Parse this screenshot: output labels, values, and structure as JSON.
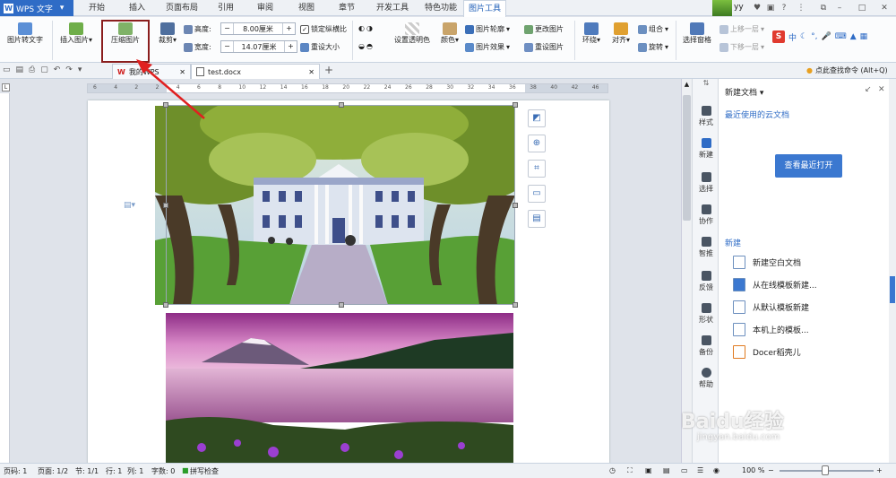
{
  "app": {
    "logo_text": "WPS 文字"
  },
  "menu": {
    "tabs": [
      "开始",
      "插入",
      "页面布局",
      "引用",
      "审阅",
      "视图",
      "章节",
      "开发工具",
      "特色功能",
      "图片工具"
    ],
    "active_tab": "图片工具",
    "user": "yy"
  },
  "ribbon": {
    "pic_to_text": "图片转文字",
    "insert_pic": "插入图片",
    "compress_pic": "压缩图片",
    "crop": "裁剪",
    "height_label": "高度:",
    "height_value": "8.00厘米",
    "width_label": "宽度:",
    "width_value": "14.07厘米",
    "lock_ratio": "锁定纵横比",
    "reset_size": "重设大小",
    "set_transparent": "设置透明色",
    "color": "颜色",
    "pic_outline": "图片轮廓",
    "pic_effect": "图片效果",
    "change_pic": "更改图片",
    "reset_pic": "重设图片",
    "wrap": "环绕",
    "align": "对齐",
    "group": "组合",
    "rotate": "旋转",
    "select_pane": "选择窗格",
    "bring_forward": "上移一层",
    "send_backward": "下移一层",
    "ime_text": "中"
  },
  "tabbar": {
    "tabs": [
      "我的WPS",
      "test.docx"
    ],
    "search_cmd": "点此查找命令 (Alt+Q)"
  },
  "ruler": {
    "h_ticks": [
      "6",
      "4",
      "2",
      "2",
      "4",
      "6",
      "8",
      "10",
      "12",
      "14",
      "16",
      "18",
      "20",
      "22",
      "24",
      "26",
      "28",
      "30",
      "32",
      "34",
      "36",
      "38",
      "40",
      "42",
      "46"
    ]
  },
  "sidepanel": {
    "items": [
      "样式",
      "新建",
      "选择",
      "协作",
      "智推",
      "反馈",
      "形状",
      "备份",
      "帮助"
    ]
  },
  "taskpane": {
    "title": "新建文档",
    "cloud_title": "最近使用的云文档",
    "open_recent": "查看最近打开",
    "new_section": "新建",
    "new_items": [
      "新建空白文档",
      "从在线模板新建...",
      "从默认模板新建",
      "本机上的模板...",
      "Docer稻壳儿"
    ]
  },
  "status": {
    "page_no": "页码: 1",
    "pages": "页面: 1/2",
    "section": "节: 1/1",
    "row": "行: 1",
    "col": "列: 1",
    "words": "字数: 0",
    "spell": "拼写检查",
    "zoom": "100 %"
  },
  "watermark": {
    "text": "Baidu经验",
    "url": "jingyan.baidu.com"
  },
  "colors": {
    "accent": "#2f6cc6",
    "highlight": "#8a1d1d",
    "arrow": "#e02020"
  }
}
